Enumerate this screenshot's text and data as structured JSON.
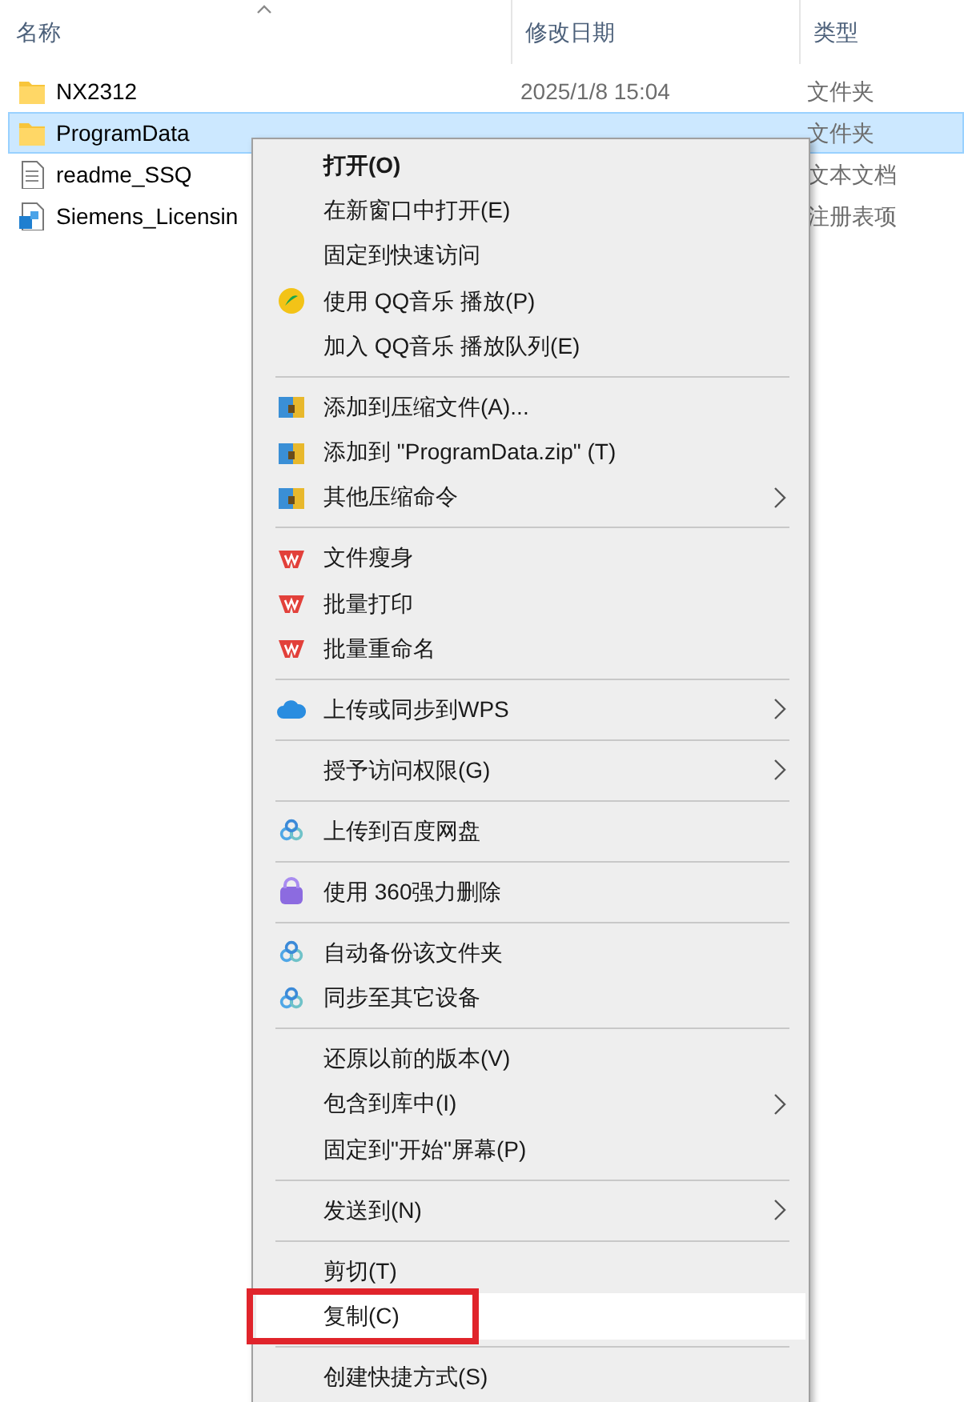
{
  "columns": [
    {
      "label": "名称",
      "sorted": true
    },
    {
      "label": "修改日期",
      "sorted": false
    },
    {
      "label": "类型",
      "sorted": false
    }
  ],
  "files": [
    {
      "name": "NX2312",
      "date": "2025/1/8 15:04",
      "type": "文件夹",
      "kind": "folder",
      "selected": false
    },
    {
      "name": "ProgramData",
      "type": "文件夹",
      "kind": "folder",
      "selected": true
    },
    {
      "name": "readme_SSQ",
      "type": "文本文档",
      "kind": "text",
      "selected": false
    },
    {
      "name": "Siemens_Licensin",
      "type": "注册表项",
      "kind": "registry",
      "selected": false
    }
  ],
  "context_menu": {
    "groups": [
      [
        {
          "label": "打开(O)",
          "default": true
        },
        {
          "label": "在新窗口中打开(E)"
        },
        {
          "label": "固定到快速访问"
        },
        {
          "label": "使用 QQ音乐 播放(P)",
          "kind": "disc"
        },
        {
          "label": "加入 QQ音乐 播放队列(E)"
        }
      ],
      [
        {
          "label": "添加到压缩文件(A)...",
          "kind": "archive"
        },
        {
          "label": "添加到 \"ProgramData.zip\" (T)",
          "kind": "archive"
        },
        {
          "label": "其他压缩命令",
          "kind": "archive",
          "submenu": true
        }
      ],
      [
        {
          "label": "文件瘦身",
          "kind": "w-mark"
        },
        {
          "label": "批量打印",
          "kind": "w-mark"
        },
        {
          "label": "批量重命名",
          "kind": "w-mark"
        }
      ],
      [
        {
          "label": "上传或同步到WPS",
          "kind": "cloud",
          "submenu": true
        }
      ],
      [
        {
          "label": "授予访问权限(G)",
          "submenu": true
        }
      ],
      [
        {
          "label": "上传到百度网盘",
          "kind": "ring-cloud"
        }
      ],
      [
        {
          "label": "使用 360强力删除",
          "kind": "lock"
        }
      ],
      [
        {
          "label": "自动备份该文件夹",
          "kind": "ring-cloud"
        },
        {
          "label": "同步至其它设备",
          "kind": "ring-cloud"
        }
      ],
      [
        {
          "label": "还原以前的版本(V)"
        },
        {
          "label": "包含到库中(I)",
          "submenu": true
        },
        {
          "label": "固定到\"开始\"屏幕(P)"
        }
      ],
      [
        {
          "label": "发送到(N)",
          "submenu": true
        }
      ],
      [
        {
          "label": "剪切(T)",
          "selected": false,
          "annotated": false
        },
        {
          "label": "复制(C)",
          "selected": true,
          "annotated": true
        }
      ],
      [
        {
          "label": "创建快捷方式(S)"
        }
      ]
    ]
  }
}
